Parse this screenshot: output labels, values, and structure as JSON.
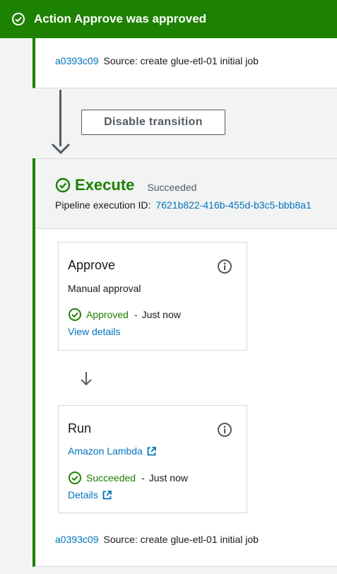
{
  "flash": {
    "message": "Action Approve was approved"
  },
  "top_stage": {
    "revision": {
      "commit": "a0393c09",
      "source": "Source: create glue-etl-01 initial job"
    }
  },
  "transition": {
    "disable_label": "Disable transition"
  },
  "stage": {
    "name": "Execute",
    "status": "Succeeded",
    "execution_label": "Pipeline execution ID:",
    "execution_id": "7621b822-416b-455d-b3c5-bbb8a1",
    "actions": [
      {
        "title": "Approve",
        "subtitle": "Manual approval",
        "status": "Approved",
        "separator": "-",
        "time": "Just now",
        "link": "View details"
      },
      {
        "title": "Run",
        "provider": "Amazon Lambda",
        "status": "Succeeded",
        "separator": "-",
        "time": "Just now",
        "link": "Details"
      }
    ],
    "revision": {
      "commit": "a0393c09",
      "source": "Source: create glue-etl-01 initial job"
    }
  },
  "colors": {
    "success": "#1d8102",
    "link": "#0073bb",
    "text": "#16191f",
    "muted": "#545b64"
  },
  "icons": [
    "check-circle-icon",
    "info-icon",
    "external-link-icon",
    "arrow-down-icon"
  ]
}
